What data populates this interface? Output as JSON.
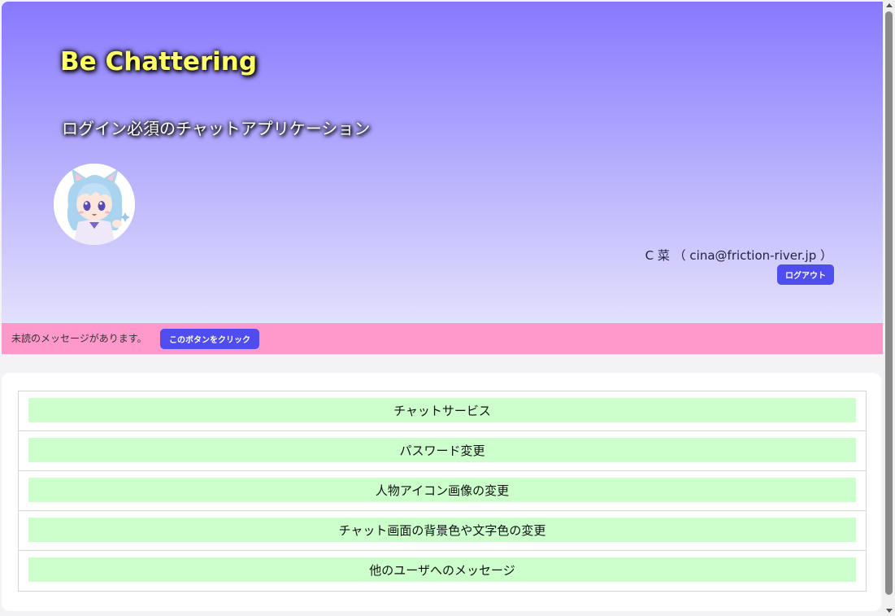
{
  "header": {
    "title": "Be Chattering",
    "subtitle": "ログイン必須のチャットアプリケーション",
    "user_display": "C 菜 （ cina@friction-river.jp ）",
    "logout_label": "ログアウト"
  },
  "notice": {
    "text": "未読のメッセージがあります。",
    "button_label": "このボタンをクリック"
  },
  "menu": {
    "items": [
      {
        "label": "チャットサービス"
      },
      {
        "label": "パスワード変更"
      },
      {
        "label": "人物アイコン画像の変更"
      },
      {
        "label": "チャット画面の背景色や文字色の変更"
      },
      {
        "label": "他のユーザへのメッセージ"
      }
    ]
  },
  "colors": {
    "header_gradient_top": "#8878ff",
    "header_gradient_bottom": "#e3e0fc",
    "title_color": "#ffff66",
    "notice_bar": "#ff99cc",
    "button_accent": "#4f4cf0",
    "menu_item_bg": "#ccffcc"
  },
  "icons": {
    "avatar": "anime-cat-girl-avatar"
  }
}
